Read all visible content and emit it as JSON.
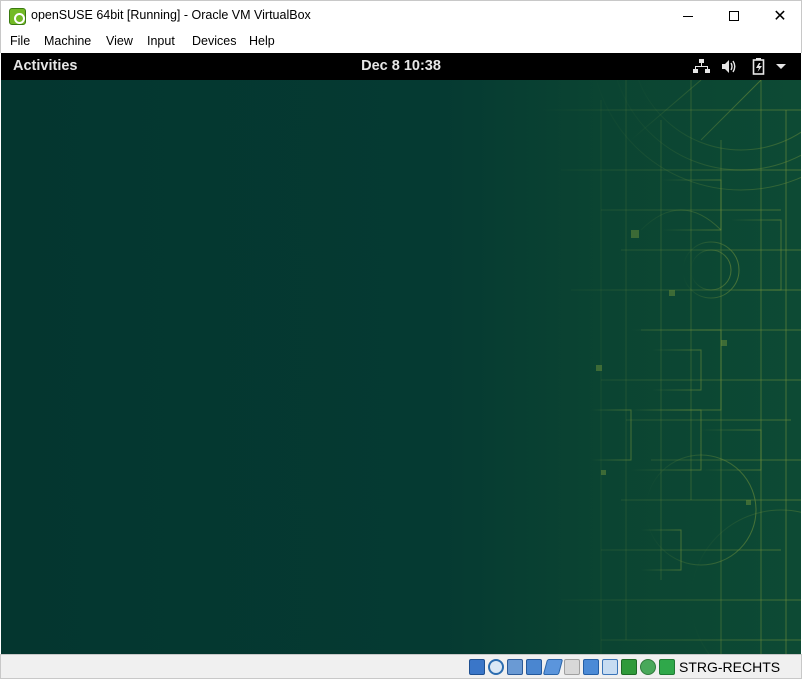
{
  "window": {
    "title": "openSUSE 64bit [Running] - Oracle VM VirtualBox",
    "app_icon": "opensuse-icon",
    "controls": [
      "minimize-icon",
      "maximize-icon",
      "close-icon"
    ]
  },
  "menu": {
    "file": "File",
    "machine": "Machine",
    "view": "View",
    "input": "Input",
    "devices": "Devices",
    "help": "Help"
  },
  "guest": {
    "activities": "Activities",
    "clock": "Dec 8  10:38",
    "tray_icons": [
      "network-icon",
      "volume-icon",
      "battery-icon",
      "system-menu-arrow-icon"
    ],
    "background_color": "#063a32",
    "pattern_color": "#6e8f3a"
  },
  "statusbar": {
    "icons": [
      "hard-disk-icon",
      "optical-drive-icon",
      "audio-icon",
      "network-adapter-icon",
      "usb-icon",
      "shared-folders-icon",
      "display-icon",
      "video-capture-icon",
      "cpu-icon",
      "mouse-integration-icon",
      "keyboard-capture-icon"
    ],
    "host_key": "STRG-RECHTS"
  },
  "colors": {
    "accent_green": "#73ba25",
    "top_bar": "#000000",
    "status_bar": "#f0f0f0"
  }
}
